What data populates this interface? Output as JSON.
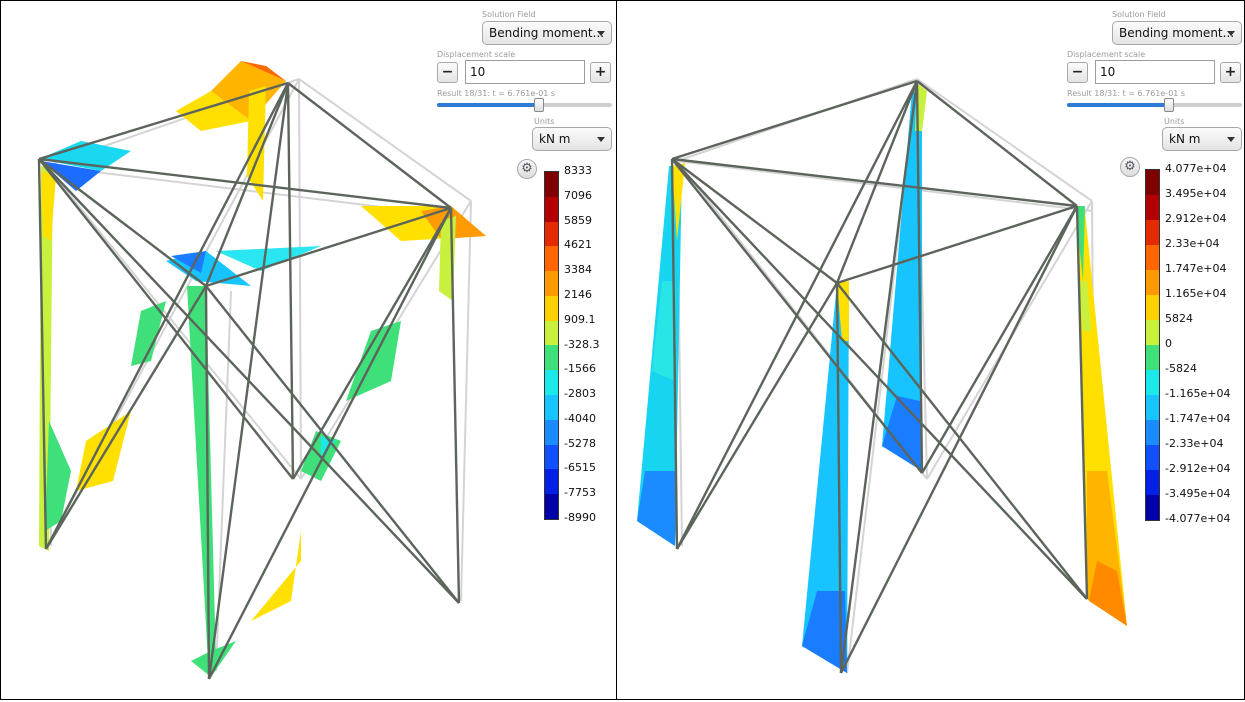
{
  "panels": [
    {
      "id": "left",
      "controls": {
        "solution_field_label": "Solution Field",
        "solution_field_value": "Bending moment...",
        "displacement_scale_label": "Displacement scale",
        "displacement_scale_value": "10",
        "minus_label": "−",
        "plus_label": "+",
        "result_label": "Result 18/31: t = 6.761e-01 s",
        "result_progress": 0.58,
        "units_label": "Units",
        "units_value": "kN m",
        "gear_icon": "gear-icon"
      },
      "legend": {
        "ticks": [
          "8333",
          "7096",
          "5859",
          "4621",
          "3384",
          "2146",
          "909.1",
          "-328.3",
          "-1566",
          "-2803",
          "-4040",
          "-5278",
          "-6515",
          "-7753",
          "-8990"
        ],
        "colors": [
          "#7f0000",
          "#b30000",
          "#e42a00",
          "#ff6600",
          "#ff9900",
          "#ffd000",
          "#c8f03c",
          "#3fe07a",
          "#1be8e8",
          "#17c4ff",
          "#1a8cff",
          "#1050ff",
          "#0020e6",
          "#0000a8"
        ]
      }
    },
    {
      "id": "right",
      "controls": {
        "solution_field_label": "Solution Field",
        "solution_field_value": "Bending moment...",
        "displacement_scale_label": "Displacement scale",
        "displacement_scale_value": "10",
        "minus_label": "−",
        "plus_label": "+",
        "result_label": "Result 18/31: t = 6.761e-01 s",
        "result_progress": 0.58,
        "units_label": "Units",
        "units_value": "kN m",
        "gear_icon": "gear-icon"
      },
      "legend": {
        "ticks": [
          "4.077e+04",
          "3.495e+04",
          "2.912e+04",
          "2.33e+04",
          "1.747e+04",
          "1.165e+04",
          "5824",
          "0",
          "-5824",
          "-1.165e+04",
          "-1.747e+04",
          "-2.33e+04",
          "-2.912e+04",
          "-3.495e+04",
          "-4.077e+04"
        ],
        "colors": [
          "#7f0000",
          "#b30000",
          "#e42a00",
          "#ff6600",
          "#ff9900",
          "#ffd000",
          "#c8f03c",
          "#3fe07a",
          "#1be8e8",
          "#17c4ff",
          "#1a8cff",
          "#1050ff",
          "#0020e6",
          "#0000a8"
        ]
      }
    }
  ],
  "colors": {
    "member": "#666e66",
    "undeformed": "#cfcfcf",
    "accent": "#2e7bd6"
  }
}
